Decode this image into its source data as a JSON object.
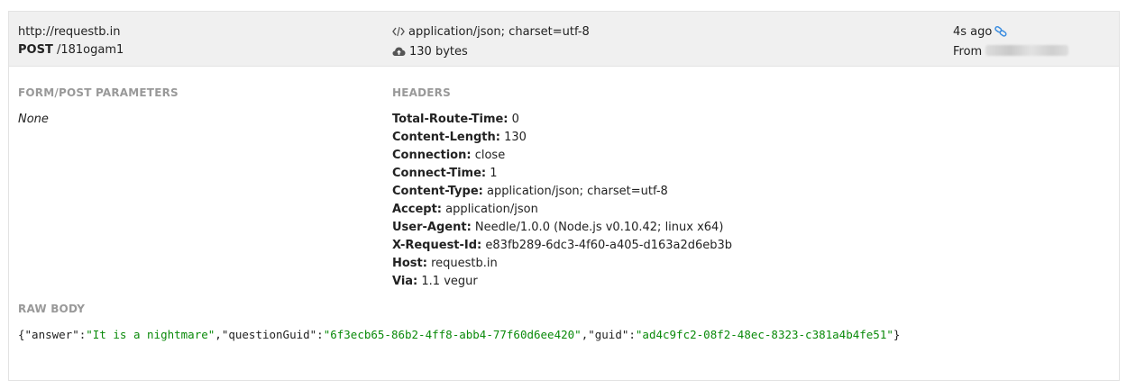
{
  "meta": {
    "host": "http://requestb.in",
    "method": "POST",
    "path": "/181ogam1",
    "content_type": "application/json; charset=utf-8",
    "size": "130 bytes",
    "time_ago": "4s ago",
    "from_label": "From"
  },
  "sections": {
    "form_title": "FORM/POST PARAMETERS",
    "form_value": "None",
    "headers_title": "HEADERS",
    "raw_title": "RAW BODY"
  },
  "headers": [
    {
      "name": "Total-Route-Time:",
      "value": "0"
    },
    {
      "name": "Content-Length:",
      "value": "130"
    },
    {
      "name": "Connection:",
      "value": "close"
    },
    {
      "name": "Connect-Time:",
      "value": "1"
    },
    {
      "name": "Content-Type:",
      "value": "application/json; charset=utf-8"
    },
    {
      "name": "Accept:",
      "value": "application/json"
    },
    {
      "name": "User-Agent:",
      "value": "Needle/1.0.0 (Node.js v0.10.42; linux x64)"
    },
    {
      "name": "X-Request-Id:",
      "value": "e83fb289-6dc3-4f60-a405-d163a2d6eb3b"
    },
    {
      "name": "Host:",
      "value": "requestb.in"
    },
    {
      "name": "Via:",
      "value": "1.1 vegur"
    }
  ],
  "raw_body": {
    "answer_key": "\"answer\"",
    "answer_val": "\"It is a nightmare\"",
    "question_key": "\"questionGuid\"",
    "question_val": "\"6f3ecb65-86b2-4ff8-abb4-77f60d6ee420\"",
    "guid_key": "\"guid\"",
    "guid_val": "\"ad4c9fc2-08f2-48ec-8323-c381a4b4fe51\""
  },
  "icons": {
    "code": "code-icon",
    "cloud": "cloud-upload-icon",
    "link": "link-icon"
  },
  "colors": {
    "link_blue": "#3b8de0",
    "json_string": "#0a8a0a",
    "section_gray": "#999999"
  }
}
